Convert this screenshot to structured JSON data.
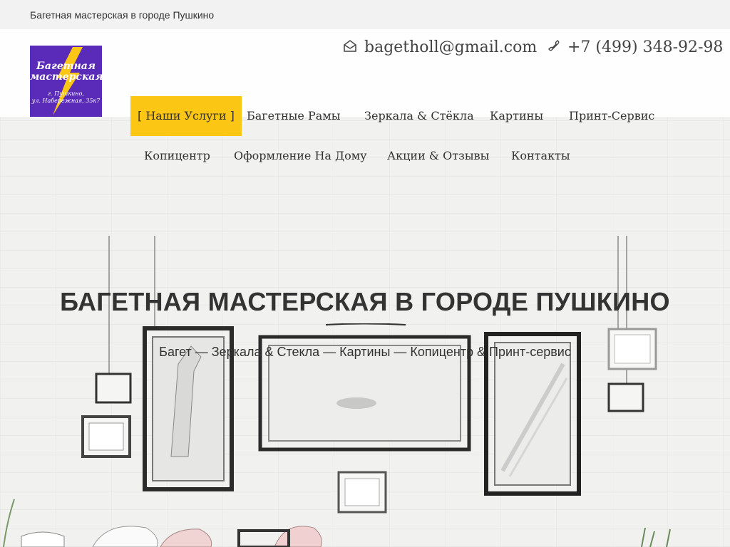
{
  "topbar": {
    "site_title": "Багетная мастерская в городе Пушкино"
  },
  "logo": {
    "line1": "Багетная",
    "line2": "мастерская",
    "line3": "г. Пушкино,",
    "line4": "ул. Набережная, 35к7"
  },
  "contacts": {
    "email_icon": "envelope-icon",
    "email": "bagetholl@gmail.com",
    "phone_icon": "phone-icon",
    "phone": "+7 (499) 348-92-98"
  },
  "nav": {
    "row1": [
      "[ Наши Услуги ]",
      "Багетные Рамы",
      "Зеркала & Стёкла",
      "Картины",
      "Принт-Сервис"
    ],
    "row2": [
      "Копицентр",
      "Оформление На Дому",
      "Акции & Отзывы",
      "Контакты"
    ]
  },
  "hero": {
    "title": "БАГЕТНАЯ МАСТЕРСКАЯ В ГОРОДЕ ПУШКИНО",
    "subtitle": "Багет — Зеркала & Стекла — Картины — Копицентр & Принт-сервис"
  },
  "colors": {
    "accent": "#fbc614",
    "logo_bg": "#5a2bb8",
    "text": "#333333",
    "topbar_bg": "#f2f2f2"
  }
}
